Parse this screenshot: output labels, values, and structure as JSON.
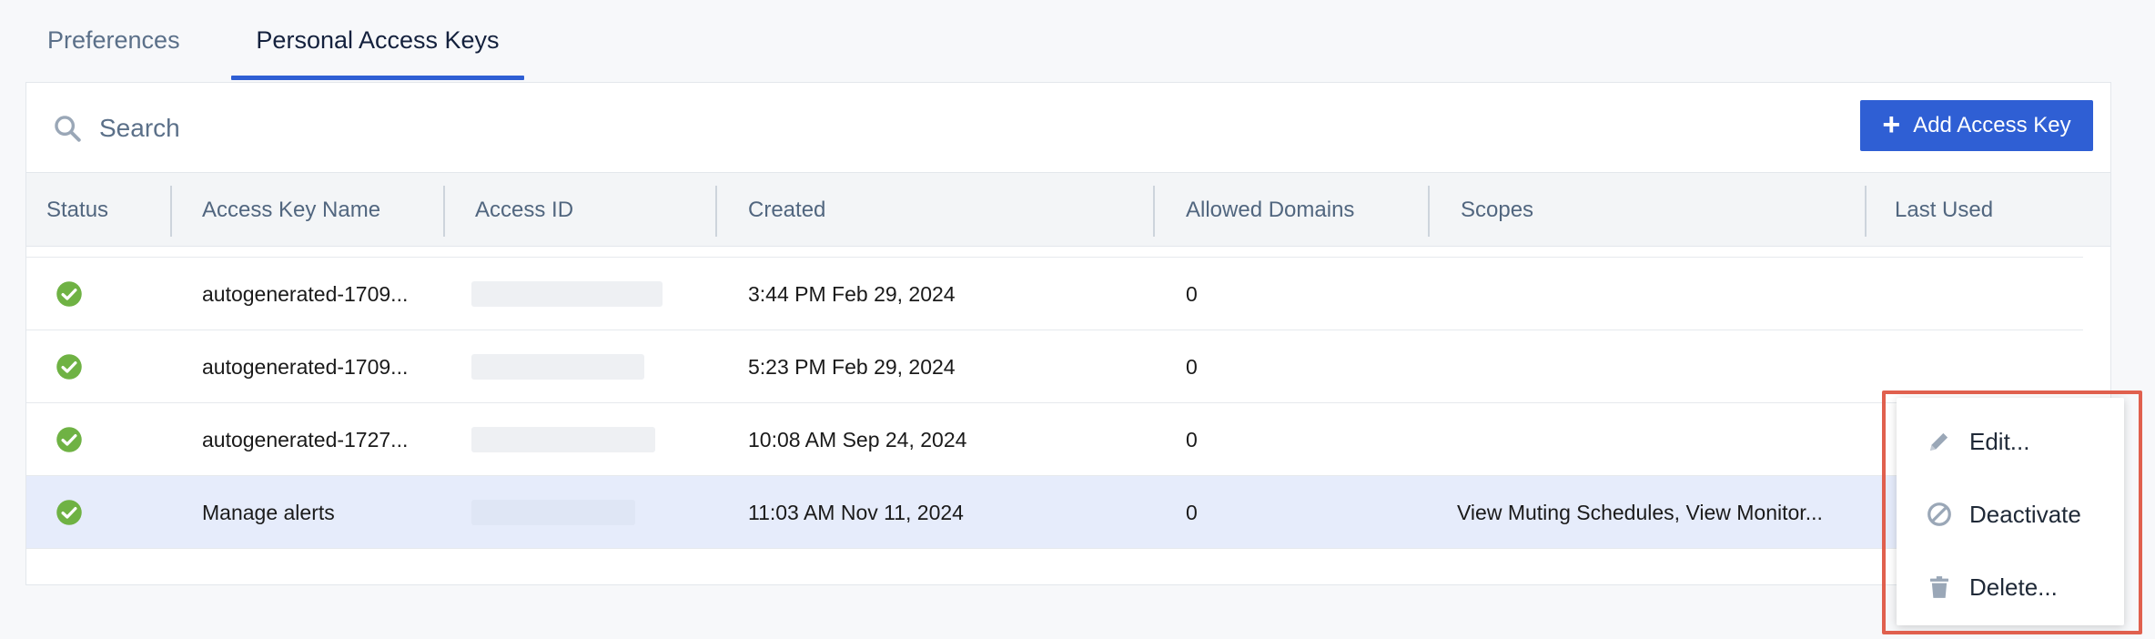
{
  "tabs": [
    {
      "label": "Preferences",
      "active": false
    },
    {
      "label": "Personal Access Keys",
      "active": true
    }
  ],
  "search": {
    "placeholder": "Search",
    "value": ""
  },
  "toolbar": {
    "add_label": "Add Access Key"
  },
  "table": {
    "columns": [
      "Status",
      "Access Key Name",
      "Access ID",
      "Created",
      "Allowed Domains",
      "Scopes",
      "Last Used"
    ],
    "rows": [
      {
        "status": "active",
        "name": "autogenerated-1709...",
        "created": "3:44 PM Feb 29, 2024",
        "allowed_domains": "0",
        "scopes": "",
        "last_used": ""
      },
      {
        "status": "active",
        "name": "autogenerated-1709...",
        "created": "5:23 PM Feb 29, 2024",
        "allowed_domains": "0",
        "scopes": "",
        "last_used": ""
      },
      {
        "status": "active",
        "name": "autogenerated-1727...",
        "created": "10:08 AM Sep 24, 2024",
        "allowed_domains": "0",
        "scopes": "",
        "last_used": ""
      },
      {
        "status": "active",
        "name": "Manage alerts",
        "created": "11:03 AM Nov 11, 2024",
        "allowed_domains": "0",
        "scopes": "View Muting Schedules, View Monitor...",
        "last_used": "",
        "selected": true
      }
    ]
  },
  "context_menu": {
    "items": [
      {
        "label": "Edit...",
        "icon": "pencil-icon"
      },
      {
        "label": "Deactivate",
        "icon": "deactivate-icon"
      },
      {
        "label": "Delete...",
        "icon": "trash-icon"
      }
    ]
  },
  "colors": {
    "accent": "#2f5fd4",
    "status_ok": "#6fb244",
    "selected_row": "#e6ecfb",
    "highlight": "#e0604e"
  }
}
